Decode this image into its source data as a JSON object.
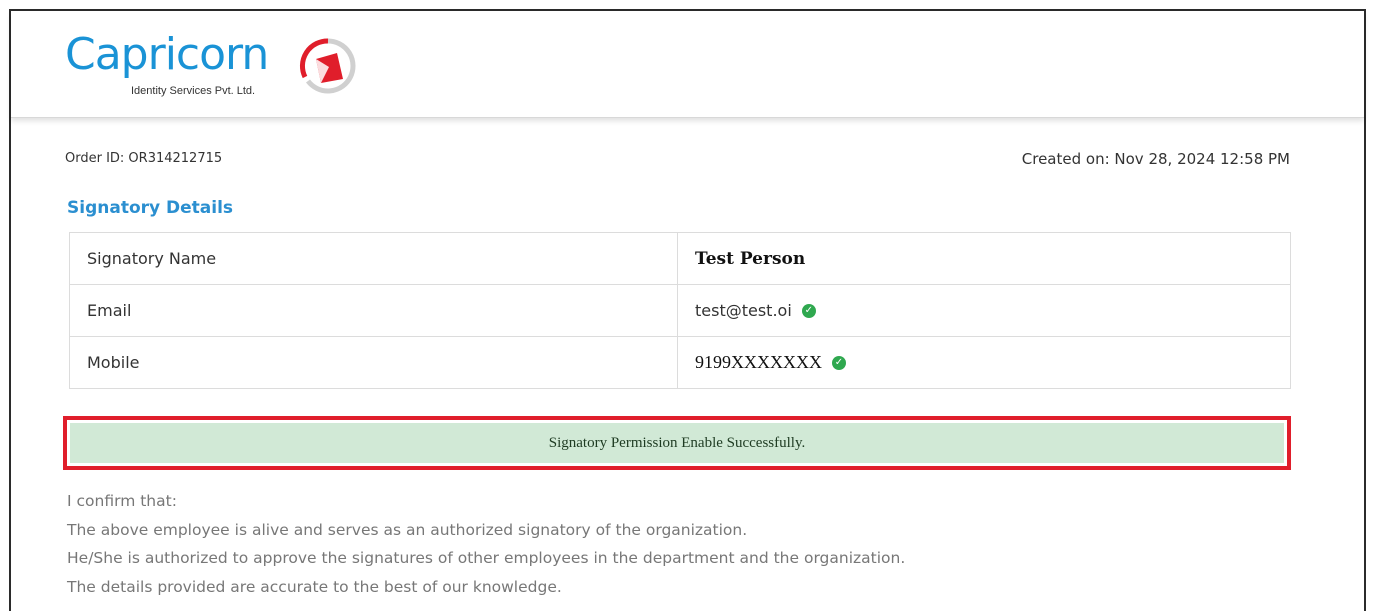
{
  "brand": {
    "name": "Capricorn",
    "subtitle": "Identity Services Pvt. Ltd.",
    "colors": {
      "primary": "#1a93d6",
      "accent": "#e01e2b",
      "success": "#2fa84f"
    }
  },
  "order": {
    "id_text": "Order ID: OR314212715",
    "created_text": "Created on: Nov 28, 2024 12:58 PM"
  },
  "signatory": {
    "title": "Signatory Details",
    "rows": [
      {
        "label": "Signatory Name",
        "value": "Test Person",
        "verified": false
      },
      {
        "label": "Email",
        "value": "test@test.oi",
        "verified": true,
        "icon": "check-circle-icon"
      },
      {
        "label": "Mobile",
        "value": "9199XXXXXXX",
        "verified": true,
        "icon": "check-circle-icon"
      }
    ]
  },
  "alert": {
    "message": "Signatory Permission Enable Successfully."
  },
  "confirmation": {
    "lines": [
      "I confirm that:",
      "The above employee is alive and serves as an authorized signatory of the organization.",
      "He/She is authorized to approve the signatures of other employees in the department and the organization.",
      "The details provided are accurate to the best of our knowledge."
    ]
  }
}
